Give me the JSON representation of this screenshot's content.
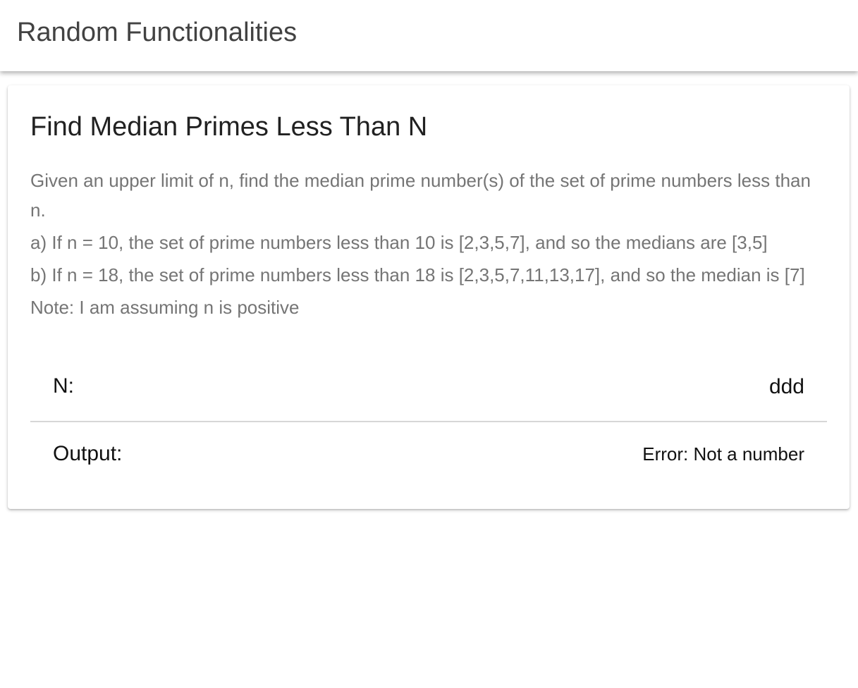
{
  "app": {
    "title": "Random Functionalities"
  },
  "card": {
    "title": "Find Median Primes Less Than N",
    "description": [
      "Given an upper limit of n, find the median prime number(s) of the set of prime numbers less than n.",
      "a) If n = 10, the set of prime numbers less than 10 is [2,3,5,7], and so the medians are [3,5]",
      "b) If n = 18, the set of prime numbers less than 18 is [2,3,5,7,11,13,17], and so the median is [7]",
      "Note: I am assuming n is positive"
    ],
    "n_label": "N:",
    "n_value": "ddd",
    "output_label": "Output:",
    "output_value": "Error: Not a number"
  },
  "colors": {
    "title_text": "#424242",
    "description_text": "#757575",
    "divider": "#d7d7d7"
  }
}
